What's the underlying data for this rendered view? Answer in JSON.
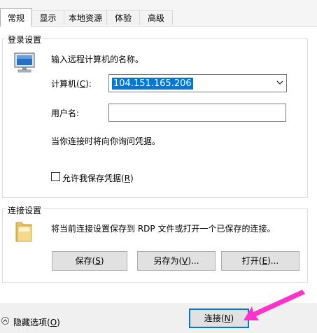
{
  "tabs": [
    {
      "label": "常规"
    },
    {
      "label": "显示"
    },
    {
      "label": "本地资源"
    },
    {
      "label": "体验"
    },
    {
      "label": "高级"
    }
  ],
  "logon": {
    "group_title": "登录设置",
    "instruction": "输入远程计算机的名称。",
    "computer_label_prefix": "计算机(",
    "computer_label_key": "C",
    "computer_label_suffix": "):",
    "computer_value": "104.151.165.206",
    "username_label": "用户名:",
    "username_value": "",
    "credential_note": "当你连接时将向你询问凭据。",
    "allow_save_prefix": "允许我保存凭据(",
    "allow_save_key": "R",
    "allow_save_suffix": ")",
    "allow_save_checked": false
  },
  "connection": {
    "group_title": "连接设置",
    "description": "将当前连接设置保存到 RDP 文件或打开一个已保存的连接。",
    "save_prefix": "保存(",
    "save_key": "S",
    "save_suffix": ")",
    "saveas_prefix": "另存为(",
    "saveas_key": "V",
    "saveas_suffix": ")...",
    "open_prefix": "打开(",
    "open_key": "E",
    "open_suffix": ")..."
  },
  "footer": {
    "hide_options_prefix": "隐藏选项(",
    "hide_options_key": "O",
    "hide_options_suffix": ")",
    "connect_prefix": "连接(",
    "connect_key": "N",
    "connect_suffix": ")"
  },
  "colors": {
    "accent": "#0078d7",
    "pointer_arrow": "#ff33cc"
  },
  "icons": {
    "computer": "computer-monitor-icon",
    "folder": "folder-icon",
    "dropdown": "chevron-down-icon",
    "collapse": "arrow-up-circle-icon",
    "pointer": "pink-arrow-annotation"
  }
}
